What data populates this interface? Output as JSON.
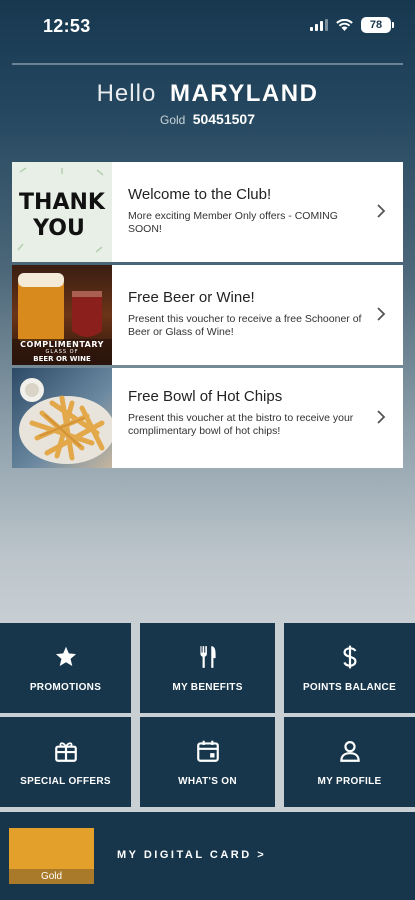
{
  "status_bar": {
    "time": "12:53",
    "battery": "78"
  },
  "greeting": {
    "hello": "Hello",
    "name": "MARYLAND",
    "tier": "Gold",
    "member_number": "50451507"
  },
  "offers": [
    {
      "title": "Welcome to the Club!",
      "description": "More exciting Member Only offers - COMING SOON!",
      "image_text": "THANK YOU"
    },
    {
      "title": "Free Beer or Wine!",
      "description": "Present this voucher to receive a free Schooner of Beer or Glass of Wine!",
      "image_text_1": "COMPLIMENTARY",
      "image_text_2": "GLASS OF",
      "image_text_3": "BEER OR WINE"
    },
    {
      "title": "Free Bowl of Hot Chips",
      "description": "Present this voucher at the bistro to receive your complimentary bowl of hot chips!"
    }
  ],
  "menu": [
    {
      "label": "PROMOTIONS",
      "icon": "star-icon"
    },
    {
      "label": "MY BENEFITS",
      "icon": "fork-knife-icon"
    },
    {
      "label": "POINTS BALANCE",
      "icon": "dollar-icon"
    },
    {
      "label": "SPECIAL OFFERS",
      "icon": "gift-icon"
    },
    {
      "label": "WHAT'S ON",
      "icon": "calendar-icon"
    },
    {
      "label": "MY PROFILE",
      "icon": "person-icon"
    }
  ],
  "digital_card": {
    "card_label": "Gold",
    "link_label": "MY DIGITAL CARD  >"
  },
  "colors": {
    "tile": "#17364c",
    "gold": "#e3a12c"
  }
}
